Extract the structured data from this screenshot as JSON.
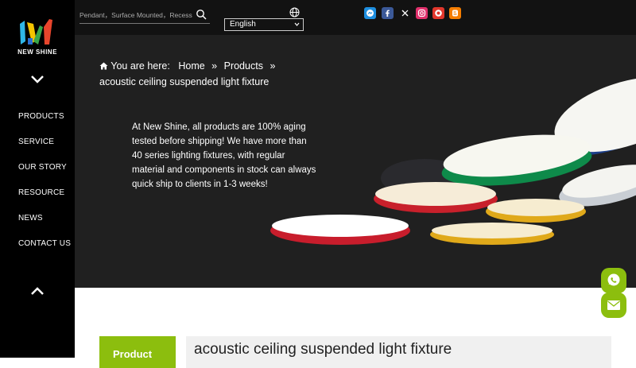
{
  "brand": {
    "name": "NEW SHINE"
  },
  "sidebar": {
    "items": [
      {
        "label": "PRODUCTS"
      },
      {
        "label": "SERVICE"
      },
      {
        "label": "OUR STORY"
      },
      {
        "label": "RESOURCE"
      },
      {
        "label": "NEWS"
      },
      {
        "label": "CONTACT US"
      }
    ]
  },
  "search": {
    "placeholder": "Pendant，Surface Mounted，Recessed"
  },
  "language": {
    "selected": "English"
  },
  "social": [
    "messenger-icon",
    "facebook-icon",
    "x-icon",
    "instagram-icon",
    "weibo-icon",
    "blogger-icon"
  ],
  "breadcrumb": {
    "prefix": "You are here:",
    "home": "Home",
    "sep": "»",
    "products": "Products",
    "current": "acoustic ceiling suspended light fixture"
  },
  "hero": {
    "text": "At New Shine, all products are 100% aging tested before shipping! We have more than 40 series lighting fixtures, with regular material and components in stock can always quick ship to clients in 1-3 weeks!"
  },
  "content": {
    "tab_label": "Product",
    "page_title": "acoustic ceiling suspended light fixture"
  },
  "colors": {
    "accent": "#8cbe0e",
    "sidebar": "#000000",
    "hero": "#202020"
  }
}
